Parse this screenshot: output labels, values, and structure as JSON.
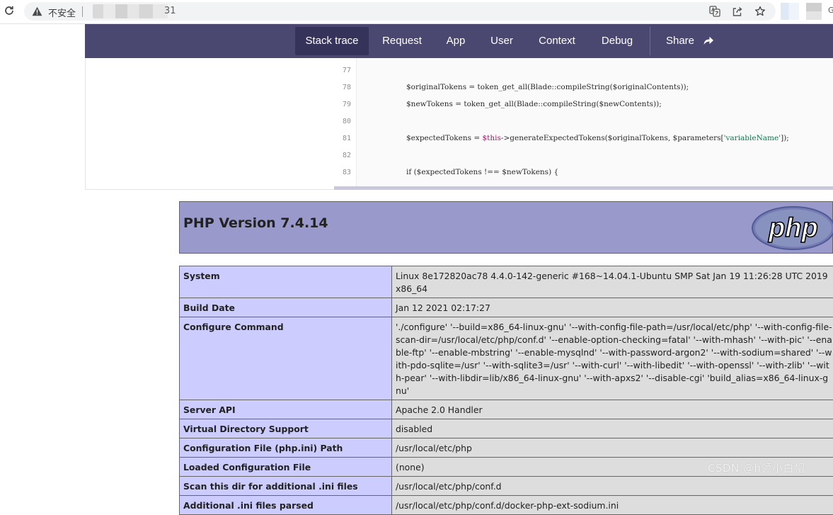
{
  "browser": {
    "security_label": "不安全",
    "url_suffix": "31",
    "profile_letter": "G",
    "icons": [
      "reload-icon",
      "warning-icon",
      "translate-icon",
      "share-page-icon",
      "bookmark-icon"
    ]
  },
  "nav": {
    "tabs": [
      {
        "label": "Stack trace",
        "active": true
      },
      {
        "label": "Request",
        "active": false
      },
      {
        "label": "App",
        "active": false
      },
      {
        "label": "User",
        "active": false
      },
      {
        "label": "Context",
        "active": false
      },
      {
        "label": "Debug",
        "active": false
      }
    ],
    "share_label": "Share",
    "colors": {
      "bar": "#4a4770",
      "active_tab": "#36335a"
    }
  },
  "code": {
    "lines": [
      {
        "num": "77",
        "text": ""
      },
      {
        "num": "78",
        "text": "$originalTokens = token_get_all(Blade::compileString($originalContents));"
      },
      {
        "num": "79",
        "text": "$newTokens = token_get_all(Blade::compileString($newContents));"
      },
      {
        "num": "80",
        "text": ""
      },
      {
        "num": "81",
        "pre": "$expectedTokens = ",
        "this": "$this",
        "mid": "->generateExpectedTokens($originalTokens, $parameters[",
        "str": "'variableName'",
        "post": "]);"
      },
      {
        "num": "82",
        "text": ""
      },
      {
        "num": "83",
        "text": "if ($expectedTokens !== $newTokens) {"
      }
    ]
  },
  "phpinfo": {
    "version": "PHP Version 7.4.14",
    "logo_text": "php",
    "colors": {
      "header": "#9999cc",
      "key_cell": "#ccccff",
      "value_cell": "#dddddd"
    },
    "rows": [
      {
        "key": "System",
        "value": "Linux 8e172820ac78 4.4.0-142-generic #168~14.04.1-Ubuntu SMP Sat Jan 19 11:26:28 UTC 2019 x86_64"
      },
      {
        "key": "Build Date",
        "value": "Jan 12 2021 02:17:27"
      },
      {
        "key": "Configure Command",
        "value": "'./configure' '--build=x86_64-linux-gnu' '--with-config-file-path=/usr/local/etc/php' '--with-config-file-scan-dir=/usr/local/etc/php/conf.d' '--enable-option-checking=fatal' '--with-mhash' '--with-pic' '--enable-ftp' '--enable-mbstring' '--enable-mysqlnd' '--with-password-argon2' '--with-sodium=shared' '--with-pdo-sqlite=/usr' '--with-sqlite3=/usr' '--with-curl' '--with-libedit' '--with-openssl' '--with-zlib' '--with-pear' '--with-libdir=lib/x86_64-linux-gnu' '--with-apxs2' '--disable-cgi' 'build_alias=x86_64-linux-gnu'"
      },
      {
        "key": "Server API",
        "value": "Apache 2.0 Handler"
      },
      {
        "key": "Virtual Directory Support",
        "value": "disabled"
      },
      {
        "key": "Configuration File (php.ini) Path",
        "value": "/usr/local/etc/php"
      },
      {
        "key": "Loaded Configuration File",
        "value": "(none)"
      },
      {
        "key": "Scan this dir for additional .ini files",
        "value": "/usr/local/etc/php/conf.d"
      },
      {
        "key": "Additional .ini files parsed",
        "value": "/usr/local/etc/php/conf.d/docker-php-ext-sodium.ini"
      }
    ]
  },
  "watermark": "CSDN @h领小白帽"
}
